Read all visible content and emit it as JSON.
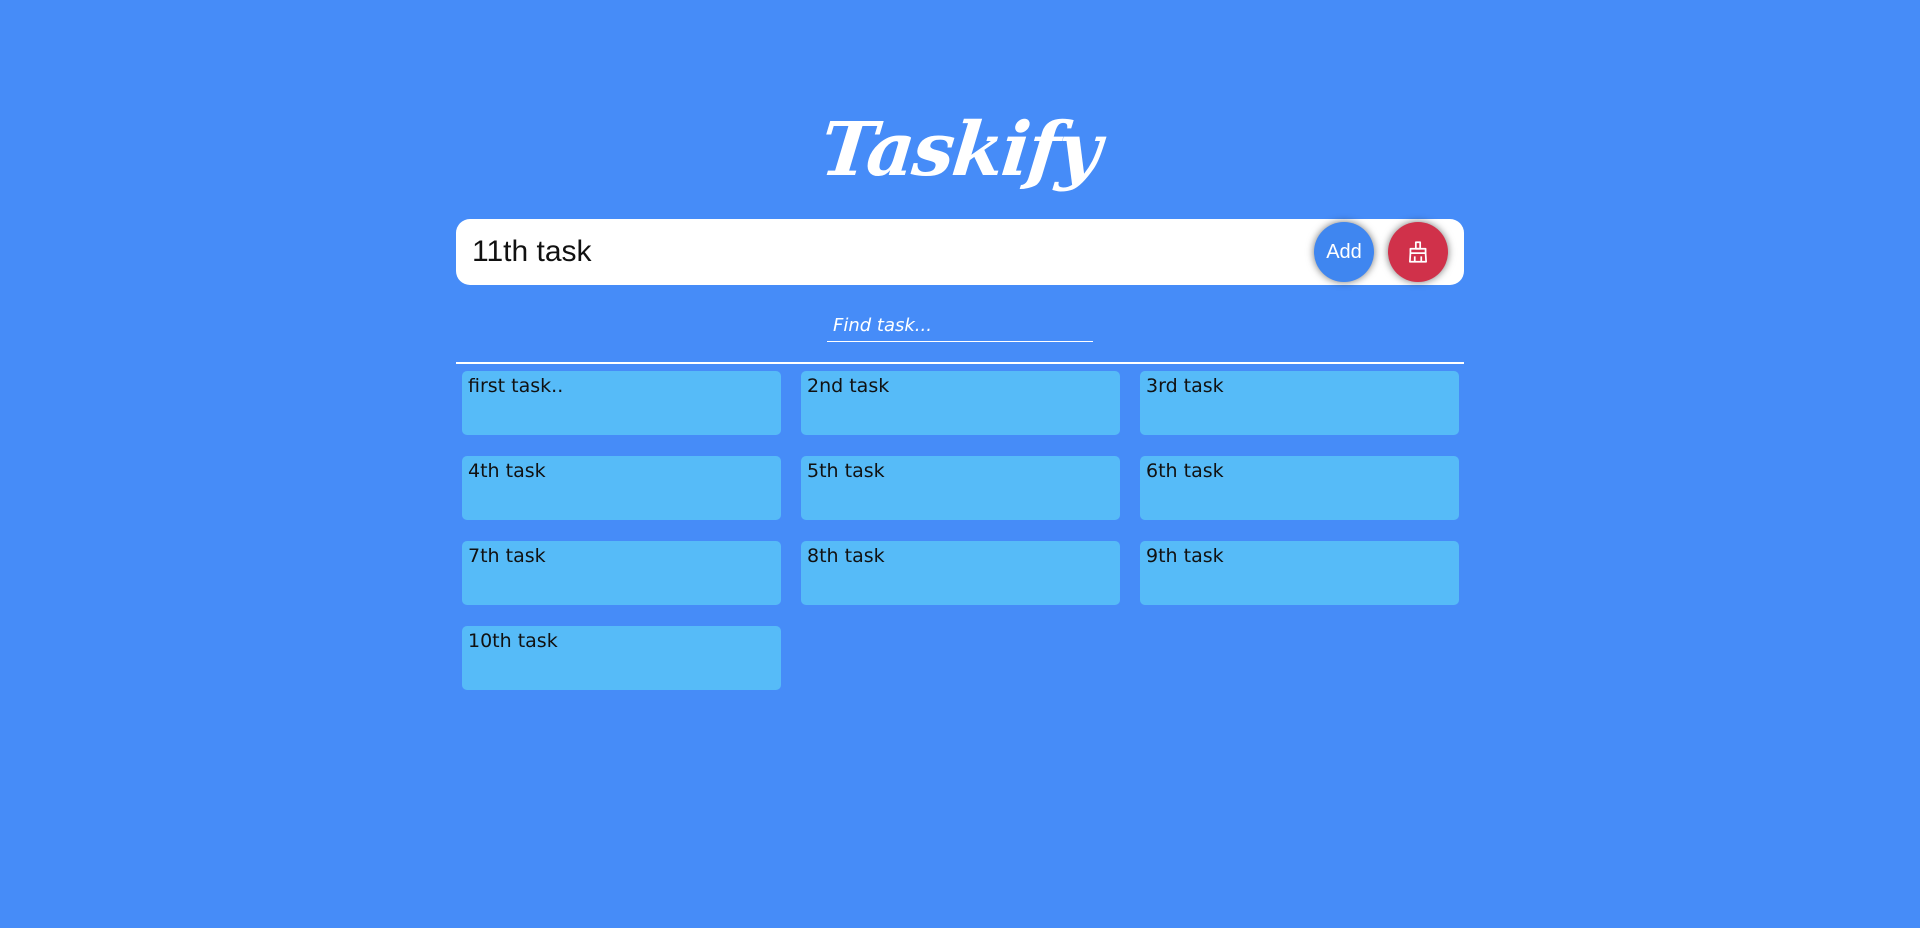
{
  "app": {
    "title": "Taskify"
  },
  "input_bar": {
    "value": "11th task",
    "add_label": "Add",
    "clear_icon": "broom-icon"
  },
  "search": {
    "placeholder": "Find task..."
  },
  "tasks": [
    {
      "text": "first task.."
    },
    {
      "text": "2nd task"
    },
    {
      "text": "3rd task"
    },
    {
      "text": "4th task"
    },
    {
      "text": "5th task"
    },
    {
      "text": "6th task"
    },
    {
      "text": "7th task"
    },
    {
      "text": "8th task"
    },
    {
      "text": "9th task"
    },
    {
      "text": "10th task"
    }
  ],
  "colors": {
    "background": "#468cf8",
    "card": "#56bbf8",
    "add_button": "#3f86f0",
    "clear_button": "#d0314a"
  }
}
